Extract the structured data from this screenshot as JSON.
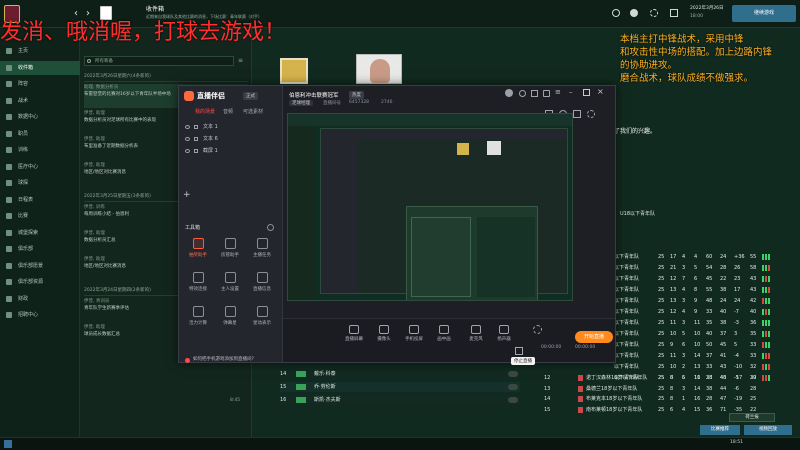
{
  "overlay": {
    "title": "发消、哦消喔，打球去游戏！",
    "notes": [
      "本档主打中锋战术，采用中锋",
      "和攻击性中场的搭配。加上边路内锋",
      "的协助进攻。",
      "磨合战术，球队成绩不做强求。"
    ]
  },
  "fm": {
    "page_title": "收件箱",
    "page_subtitle": "近期来自我球队及其他比赛的消息，下场比赛：青年联赛（对手）",
    "date": "2022年3月26日",
    "time": "18:00",
    "continue_button": "继续游戏",
    "top_links": [
      "CA/PA对比",
      "英冠联赛",
      "球队事项"
    ],
    "sidebar": [
      {
        "label": "主页",
        "active": false
      },
      {
        "label": "收件箱",
        "active": true
      },
      {
        "label": "阵容",
        "active": false
      },
      {
        "label": "战术",
        "active": false
      },
      {
        "label": "数据中心",
        "active": false
      },
      {
        "label": "职员",
        "active": false
      },
      {
        "label": "训练",
        "active": false
      },
      {
        "label": "医疗中心",
        "active": false
      },
      {
        "label": "球探",
        "active": false
      },
      {
        "label": "日程表",
        "active": false
      },
      {
        "label": "比赛",
        "active": false
      },
      {
        "label": "城堡探索",
        "active": false
      },
      {
        "label": "俱乐部",
        "active": false
      },
      {
        "label": "俱乐部愿景",
        "active": false
      },
      {
        "label": "俱乐部资源",
        "active": false
      },
      {
        "label": "财政",
        "active": false
      },
      {
        "label": "招聘中心",
        "active": false
      }
    ],
    "inbox": {
      "search_placeholder": "所有筹备",
      "groups": [
        {
          "date": "2022年3月26日星期六(4条新的)",
          "messages": [
            {
              "from": "助理, 数据分析员",
              "text": "布雷登堡的比赛对16岁以下青年队半场中场",
              "selected": true
            },
            {
              "from": "伊普, 助理",
              "text": "数据分析员对足球所有比赛中的表现",
              "selected": false
            },
            {
              "from": "伊普, 助理",
              "text": "布里准备了近期数据分析表",
              "selected": false
            },
            {
              "from": "伊普, 助理",
              "text": "地区/地区对比赛消息",
              "selected": false
            }
          ]
        },
        {
          "date": "2022年3月25日星期五(3条新的)",
          "messages": [
            {
              "from": "伊普, 训练",
              "text": "每周训练小结 - 伯恩利",
              "selected": false
            },
            {
              "from": "伊普, 助理",
              "text": "数据分析员汇总",
              "selected": false
            },
            {
              "from": "伊普, 助理",
              "text": "地区/地区对比赛消息",
              "selected": false
            }
          ]
        },
        {
          "date": "2022年3月24日星期四(2条新的)",
          "messages": [
            {
              "from": "伊普, 青训员",
              "text": "青年队学生新赛季评估",
              "selected": false
            },
            {
              "from": "伊普, 助理",
              "text": "球员成长数据汇总",
              "selected": false
            }
          ]
        }
      ],
      "time_stamp": "8:45"
    },
    "headline_right": "了我们的兴趣。",
    "league_label": "U18以下青年队",
    "table": [
      {
        "name": "以下青年队",
        "p": "25",
        "w": "17",
        "d": "4",
        "l": "4",
        "gf": "60",
        "ga": "24",
        "gd": "+36",
        "pts": "55",
        "form": "WWWLW"
      },
      {
        "name": "以下青年队",
        "p": "25",
        "w": "21",
        "d": "3",
        "l": "5",
        "gf": "54",
        "ga": "28",
        "gd": "26",
        "pts": "58",
        "form": "WWLWW"
      },
      {
        "name": "以下青年队",
        "p": "25",
        "w": "12",
        "d": "7",
        "l": "6",
        "gf": "45",
        "ga": "22",
        "gd": "23",
        "pts": "43",
        "form": "WLWWW"
      },
      {
        "name": "以下青年队",
        "p": "25",
        "w": "13",
        "d": "4",
        "l": "8",
        "gf": "55",
        "ga": "38",
        "gd": "17",
        "pts": "43",
        "form": "WWLWW"
      },
      {
        "name": "以下青年队",
        "p": "25",
        "w": "13",
        "d": "3",
        "l": "9",
        "gf": "48",
        "ga": "24",
        "gd": "24",
        "pts": "42",
        "form": "LWWWW"
      },
      {
        "name": "以下青年队",
        "p": "25",
        "w": "12",
        "d": "4",
        "l": "9",
        "gf": "33",
        "ga": "40",
        "gd": "-7",
        "pts": "40",
        "form": "WLWWW"
      },
      {
        "name": "以下青年队",
        "p": "25",
        "w": "11",
        "d": "3",
        "l": "11",
        "gf": "35",
        "ga": "38",
        "gd": "-3",
        "pts": "36",
        "form": "WWWLW"
      },
      {
        "name": "以下青年队",
        "p": "25",
        "w": "10",
        "d": "5",
        "l": "10",
        "gf": "40",
        "ga": "37",
        "gd": "3",
        "pts": "35",
        "form": "WLWLW"
      },
      {
        "name": "以下青年队",
        "p": "25",
        "w": "9",
        "d": "6",
        "l": "10",
        "gf": "50",
        "ga": "45",
        "gd": "5",
        "pts": "33",
        "form": "LWWLW"
      },
      {
        "name": "以下青年队",
        "p": "25",
        "w": "11",
        "d": "3",
        "l": "14",
        "gf": "37",
        "ga": "41",
        "gd": "-4",
        "pts": "33",
        "form": "WLLWW"
      },
      {
        "name": "以下青年队",
        "p": "25",
        "w": "10",
        "d": "2",
        "l": "13",
        "gf": "33",
        "ga": "43",
        "gd": "-10",
        "pts": "32",
        "form": "LWLWW"
      },
      {
        "name": "以下青年队",
        "p": "25",
        "w": "8",
        "d": "6",
        "l": "11",
        "gf": "28",
        "ga": "45",
        "gd": "-17",
        "pts": "30",
        "form": "LLWLW"
      }
    ],
    "bottom_table": [
      {
        "pos": "12",
        "name": "诺丁汉森林16岁以下青年队",
        "p": "25",
        "w": "8",
        "d": "5",
        "l": "10",
        "gf": "38",
        "ga": "40",
        "gd": "-5",
        "pts": "29"
      },
      {
        "pos": "13",
        "name": "桑德兰18岁以下青年队",
        "p": "25",
        "w": "8",
        "d": "3",
        "l": "14",
        "gf": "38",
        "ga": "44",
        "gd": "-6",
        "pts": "28"
      },
      {
        "pos": "14",
        "name": "布莱克本18岁以下青年队",
        "p": "25",
        "w": "8",
        "d": "1",
        "l": "16",
        "gf": "28",
        "ga": "47",
        "gd": "-19",
        "pts": "25"
      },
      {
        "pos": "15",
        "name": "南布莱顿18岁以下青年队",
        "p": "25",
        "w": "6",
        "d": "4",
        "l": "15",
        "gf": "36",
        "ga": "71",
        "gd": "-35",
        "pts": "22"
      }
    ],
    "squad_rows": [
      {
        "num": "14",
        "name": "戴乐·科泰",
        "selected": false
      },
      {
        "num": "15",
        "name": "乔·劳伦斯",
        "selected": false
      },
      {
        "num": "16",
        "name": "斯凯·杰夫斯",
        "selected": false
      }
    ],
    "bottom_buttons": [
      "比赛推荐",
      "视频回放"
    ],
    "footer_btn": "荷兰报",
    "clock": "18:51"
  },
  "stream": {
    "app_name": "直播伴侣",
    "version": "正式",
    "tabs": [
      "我的场景",
      "音频",
      "可选素材"
    ],
    "sources": [
      "文本 1",
      "文本 6",
      "截屏 1"
    ],
    "tools_title": "工具箱",
    "tools": [
      {
        "label": "抽奖助手",
        "hot": true
      },
      {
        "label": "房管助手",
        "hot": false
      },
      {
        "label": "主播任务",
        "hot": false
      },
      {
        "label": "特效连接",
        "hot": false
      },
      {
        "label": "主人设置",
        "hot": false
      },
      {
        "label": "直播信息",
        "hot": false
      },
      {
        "label": "活力计算",
        "hot": false
      },
      {
        "label": "弹幕星",
        "hot": false
      },
      {
        "label": "星动表示",
        "hot": false
      }
    ],
    "tip": "如何把手机游戏添加到直播间?",
    "room_title": "伯恩利冲击联赛冠军",
    "room_tag": "热度",
    "room_category": "足球经理",
    "room_id_label": "直播间号",
    "room_id": "6457328",
    "room_count": "2746",
    "controls": [
      "直播屏幕",
      "摄像头",
      "手机投屏",
      "画中画",
      "麦克风",
      "扬声器",
      "停止直播",
      "设置"
    ],
    "tooltip": "停止直播",
    "timer1": "00:00:00",
    "timer2": "00:00:00",
    "start_button": "开始直播"
  },
  "colors": {
    "overlay_red": "#ff2e2e",
    "overlay_orange": "#ffb020",
    "fm_green": "#1e4f38",
    "accent_orange": "#ff8a1e"
  }
}
